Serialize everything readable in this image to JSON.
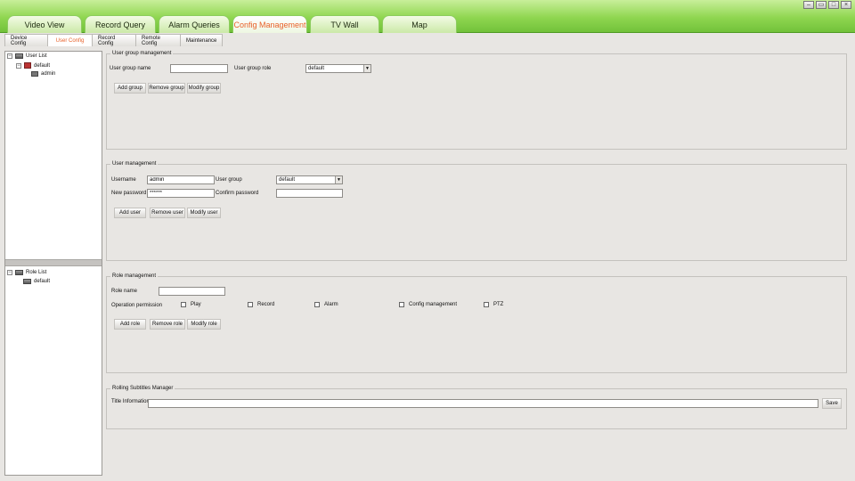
{
  "window": {
    "minimize": "–",
    "restore": "▭",
    "maximize": "□",
    "close": "×"
  },
  "tabs": [
    {
      "label": "Video View"
    },
    {
      "label": "Record Query"
    },
    {
      "label": "Alarm Queries"
    },
    {
      "label": "Config Management"
    },
    {
      "label": "TV Wall"
    },
    {
      "label": "Map"
    }
  ],
  "subtabs": [
    {
      "label": "Device Config"
    },
    {
      "label": "User Config"
    },
    {
      "label": "Record Config"
    },
    {
      "label": "Remote Config"
    },
    {
      "label": "Maintenance"
    }
  ],
  "user_tree": {
    "expander": "−",
    "root": "User List",
    "group_expander": "−",
    "group": "default",
    "user": "admin"
  },
  "role_tree": {
    "expander": "−",
    "root": "Role List",
    "role": "default"
  },
  "user_group": {
    "title": "User group management",
    "name_label": "User group name",
    "name_value": "",
    "role_label": "User group role",
    "role_value": "default",
    "add": "Add group",
    "remove": "Remove group",
    "modify": "Modify group"
  },
  "user_mgmt": {
    "title": "User management",
    "username_label": "Username",
    "username_value": "admin",
    "group_label": "User group",
    "group_value": "default",
    "newpw_label": "New password",
    "newpw_value": "******",
    "confirm_label": "Confirm password",
    "confirm_value": "",
    "add": "Add user",
    "remove": "Remove user",
    "modify": "Modify user"
  },
  "role_mgmt": {
    "title": "Role management",
    "name_label": "Role name",
    "name_value": "",
    "perm_label": "Operation permission",
    "perms": [
      "Play",
      "Record",
      "Alarm",
      "Config management",
      "PTZ"
    ],
    "add": "Add role",
    "remove": "Remove role",
    "modify": "Modify role"
  },
  "subtitles": {
    "title": "Rolling Subtitles Manager",
    "info_label": "Title Information",
    "info_value": "",
    "save": "Save"
  },
  "colors": {
    "accent": "#e8612a",
    "chrome_green": "#8fd650"
  },
  "icons": [
    "tree-collapse-icon",
    "user-list-icon",
    "group-icon",
    "user-icon",
    "role-list-icon",
    "role-icon",
    "dropdown-arrow-icon",
    "checkbox-icon"
  ]
}
